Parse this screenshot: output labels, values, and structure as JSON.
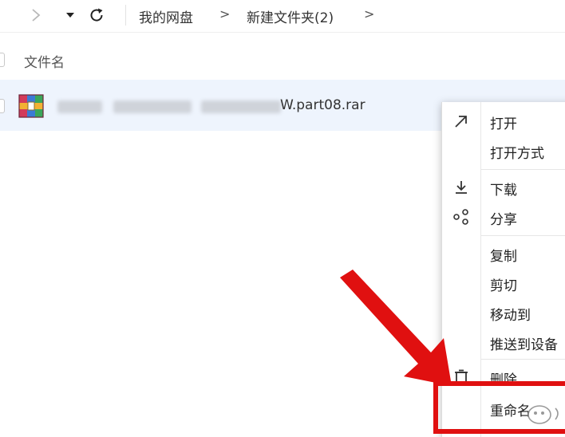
{
  "toolbar": {
    "breadcrumb": [
      {
        "label": "我的网盘"
      },
      {
        "label": "新建文件夹(2)"
      }
    ],
    "separator": ">"
  },
  "file_list": {
    "column_header": "文件名",
    "rows": [
      {
        "name_visible_suffix": "W.part08.rar",
        "name_prefix_blurred": true,
        "icon": "winrar-archive-icon",
        "selected": true
      }
    ]
  },
  "context_menu": {
    "items": [
      {
        "label": "打开",
        "icon": "open-arrow-icon"
      },
      {
        "label": "打开方式",
        "icon": ""
      },
      {
        "label": "下载",
        "icon": "download-icon"
      },
      {
        "label": "分享",
        "icon": "share-icon"
      },
      {
        "label": "复制",
        "icon": ""
      },
      {
        "label": "剪切",
        "icon": ""
      },
      {
        "label": "移动到",
        "icon": ""
      },
      {
        "label": "推送到设备",
        "icon": ""
      },
      {
        "label": "删除",
        "icon": "trash-icon"
      },
      {
        "label": "重命名",
        "icon": ""
      }
    ]
  },
  "annotation": {
    "arrow_color": "#e01010",
    "highlight_color": "#e01010"
  }
}
